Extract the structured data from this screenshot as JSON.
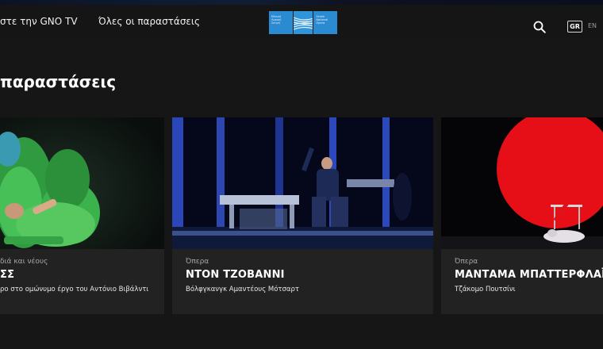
{
  "nav": {
    "link1": "στε την GNO TV",
    "link2": "Όλες οι παραστάσεις",
    "logo": {
      "left_lines": [
        "Εθνική",
        "Λυρική",
        "Σκηνή"
      ],
      "right_lines": [
        "Greek",
        "National",
        "Opera"
      ],
      "color": "#2a8bd0"
    },
    "lang_gr": "GR",
    "lang_en": "EN"
  },
  "section_title": "παραστάσεις",
  "cards": [
    {
      "category": "διά και νέους",
      "title": "ΣΣ",
      "subtitle": "ρο στο ομώνυμο έργο του Αντόνιο Βιβάλντι"
    },
    {
      "category": "Όπερα",
      "title": "ΝΤΟΝ ΤΖΟΒΑΝΝΙ",
      "subtitle": "Βόλφγκανγκ Αμαντέους Μότσαρτ"
    },
    {
      "category": "Όπερα",
      "title": "ΜΑΝΤΑΜΑ ΜΠΑΤΤΕΡΦΛΑΪ",
      "subtitle": "Τζάκομο Πουτσίνι"
    }
  ]
}
